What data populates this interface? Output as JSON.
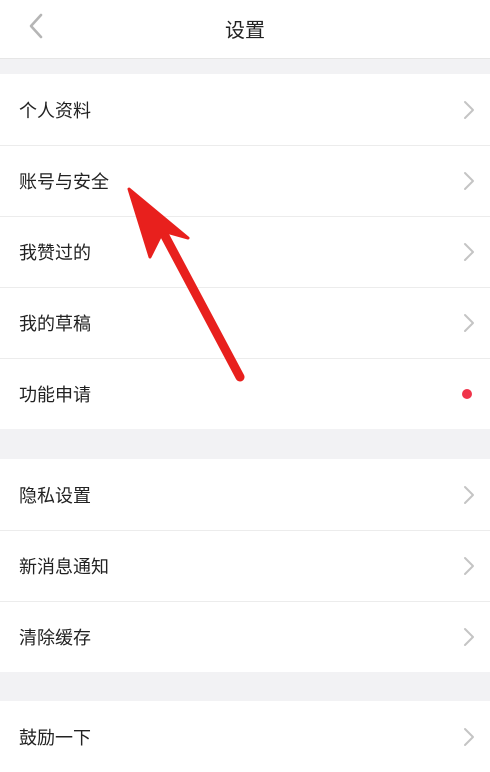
{
  "header": {
    "title": "设置",
    "back_icon": "chevron-left-icon"
  },
  "group1": [
    {
      "label": "个人资料",
      "trailing": "chevron-right-icon"
    },
    {
      "label": "账号与安全",
      "trailing": "chevron-right-icon"
    },
    {
      "label": "我赞过的",
      "trailing": "chevron-right-icon"
    },
    {
      "label": "我的草稿",
      "trailing": "chevron-right-icon"
    },
    {
      "label": "功能申请",
      "trailing": "red-dot-badge"
    }
  ],
  "group2": [
    {
      "label": "隐私设置",
      "trailing": "chevron-right-icon"
    },
    {
      "label": "新消息通知",
      "trailing": "chevron-right-icon"
    },
    {
      "label": "清除缓存",
      "trailing": "chevron-right-icon"
    }
  ],
  "group3": [
    {
      "label": "鼓励一下",
      "trailing": "chevron-right-icon"
    }
  ],
  "colors": {
    "background": "#f2f2f4",
    "row_background": "#ffffff",
    "badge_red": "#f0344a",
    "annotation_arrow": "#e8201d"
  },
  "annotation": {
    "icon": "red-arrow-annotation",
    "points_to": "账号与安全"
  }
}
